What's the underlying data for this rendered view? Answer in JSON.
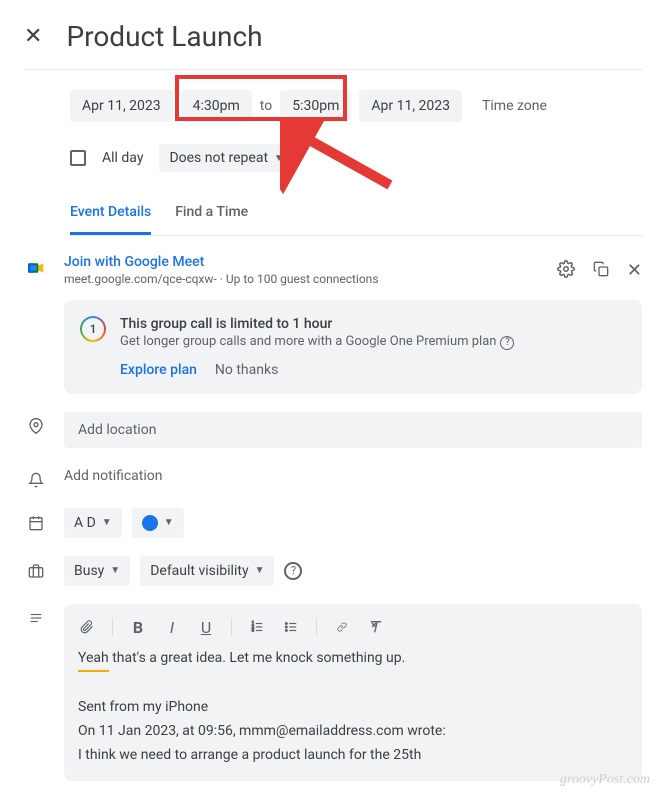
{
  "title": "Product Launch",
  "datetime": {
    "start_date": "Apr 11, 2023",
    "start_time": "4:30pm",
    "to_label": "to",
    "end_time": "5:30pm",
    "end_date": "Apr 11, 2023",
    "timezone_label": "Time zone"
  },
  "allday": {
    "label": "All day",
    "repeat": "Does not repeat"
  },
  "tabs": {
    "details": "Event Details",
    "findtime": "Find a Time"
  },
  "meet": {
    "join_label": "Join with Google Meet",
    "url": "meet.google.com/qce-cqxw-",
    "connections": "Up to 100 guest connections"
  },
  "info": {
    "badge": "1",
    "title": "This group call is limited to 1 hour",
    "desc": "Get longer group calls and more with a Google One Premium plan",
    "explore": "Explore plan",
    "nothanks": "No thanks"
  },
  "location": {
    "placeholder": "Add location"
  },
  "notification": {
    "label": "Add notification"
  },
  "calendar": {
    "owner": "A D"
  },
  "visibility": {
    "busy": "Busy",
    "default": "Default visibility"
  },
  "description": {
    "yeah": "Yeah",
    "line1_rest": " that's a great idea. Let me knock something up.",
    "line2": "Sent from my iPhone",
    "line3": "On 11 Jan 2023, at 09:56, mmm@emailaddress.com wrote:",
    "line4": "I think we need to arrange a product launch for the 25th"
  },
  "watermark": "groovyPost.com"
}
